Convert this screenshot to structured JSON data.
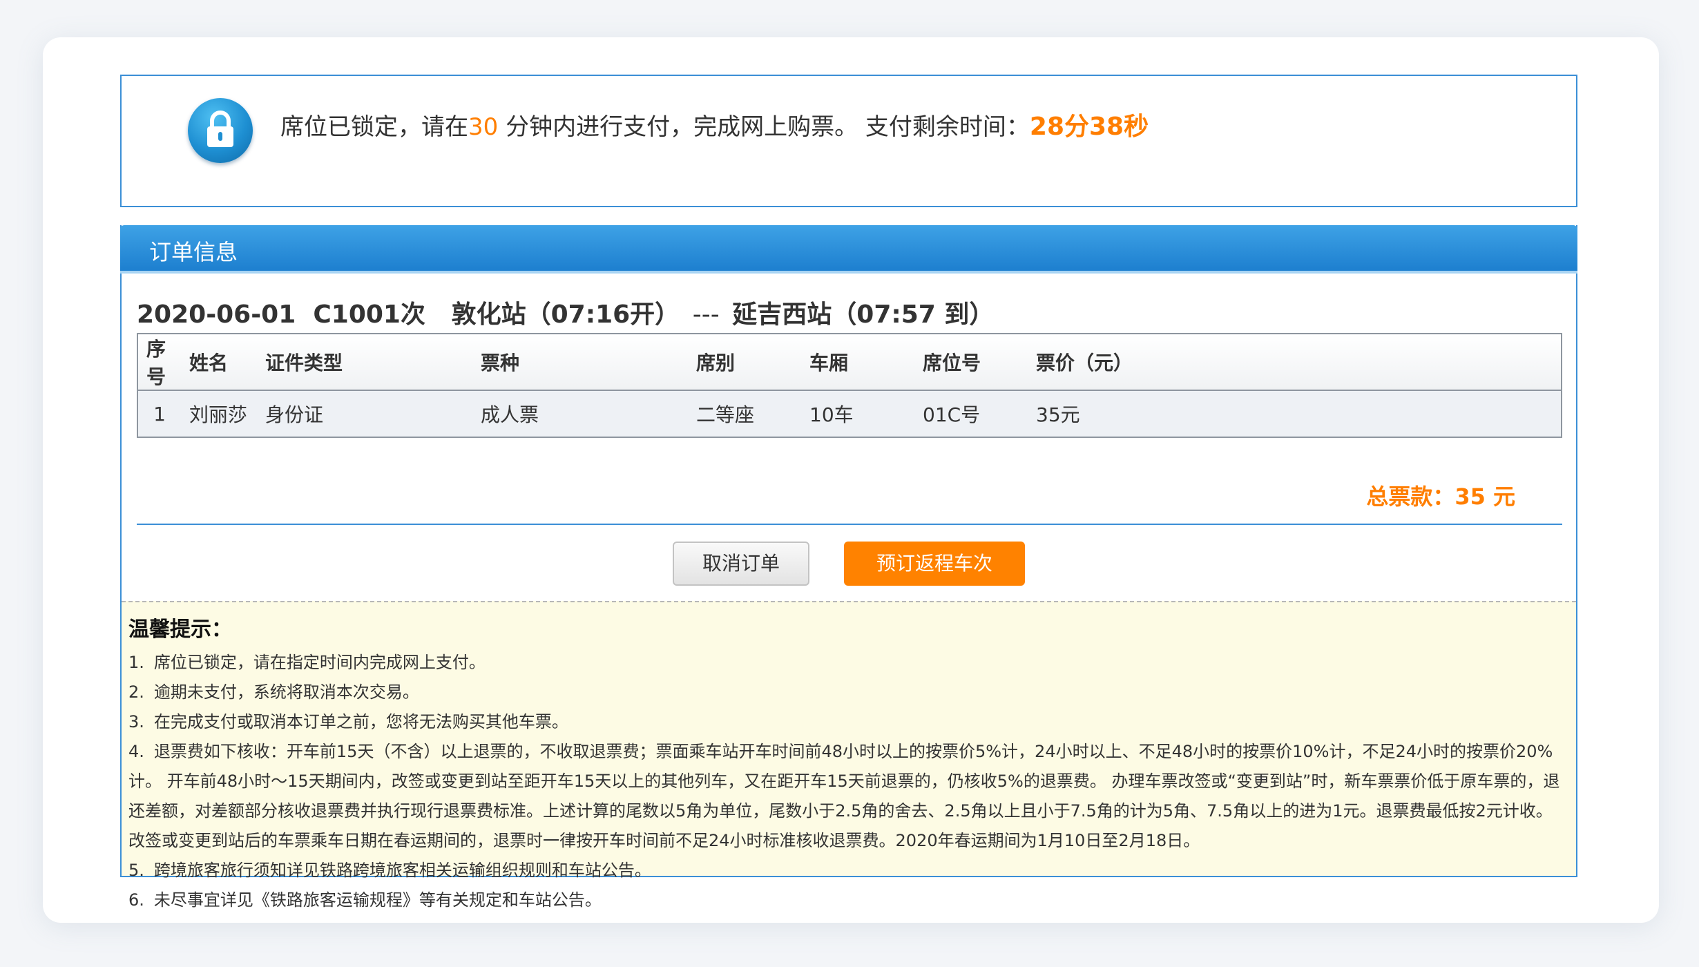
{
  "lock_notice": {
    "prefix": "席位已锁定，请在",
    "minutes": "30",
    "suffix": " 分钟内进行支付，完成网上购票。 支付剩余时间：",
    "remaining": "28分38秒"
  },
  "order": {
    "panel_title": "订单信息",
    "date": "2020-06-01",
    "train": "C1001次",
    "depart": "敦化站（07:16开）",
    "separator": "---",
    "arrive": "延吉西站（07:57 到）",
    "columns": [
      "序号",
      "姓名",
      "证件类型",
      "票种",
      "席别",
      "车厢",
      "席位号",
      "票价（元）"
    ],
    "rows": [
      [
        "1",
        "刘丽莎",
        "身份证",
        "成人票",
        "二等座",
        "10车",
        "01C号",
        "35元"
      ]
    ],
    "total": "总票款：35 元"
  },
  "buttons": {
    "cancel": "取消订单",
    "return_trip": "预订返程车次"
  },
  "tips": {
    "title": "温馨提示：",
    "items": [
      {
        "num": "1.",
        "text": "席位已锁定，请在指定时间内完成网上支付。"
      },
      {
        "num": "2.",
        "text": "逾期未支付，系统将取消本次交易。"
      },
      {
        "num": "3.",
        "text": "在完成支付或取消本订单之前，您将无法购买其他车票。"
      },
      {
        "num": "4.",
        "text": "退票费如下核收：开车前15天（不含）以上退票的，不收取退票费；票面乘车站开车时间前48小时以上的按票价5%计，24小时以上、不足48小时的按票价10%计，不足24小时的按票价20%计。 开车前48小时～15天期间内，改签或变更到站至距开车15天以上的其他列车，又在距开车15天前退票的，仍核收5%的退票费。 办理车票改签或“变更到站”时，新车票票价低于原车票的，退还差额，对差额部分核收退票费并执行现行退票费标准。上述计算的尾数以5角为单位，尾数小于2.5角的舍去、2.5角以上且小于7.5角的计为5角、7.5角以上的进为1元。退票费最低按2元计收。 改签或变更到站后的车票乘车日期在春运期间的，退票时一律按开车时间前不足24小时标准核收退票费。2020年春运期间为1月10日至2月18日。"
      },
      {
        "num": "5.",
        "text": "跨境旅客旅行须知详见铁路跨境旅客相关运输组织规则和车站公告。"
      },
      {
        "num": "6.",
        "text": "未尽事宜详见《铁路旅客运输规程》等有关规定和车站公告。"
      }
    ]
  }
}
